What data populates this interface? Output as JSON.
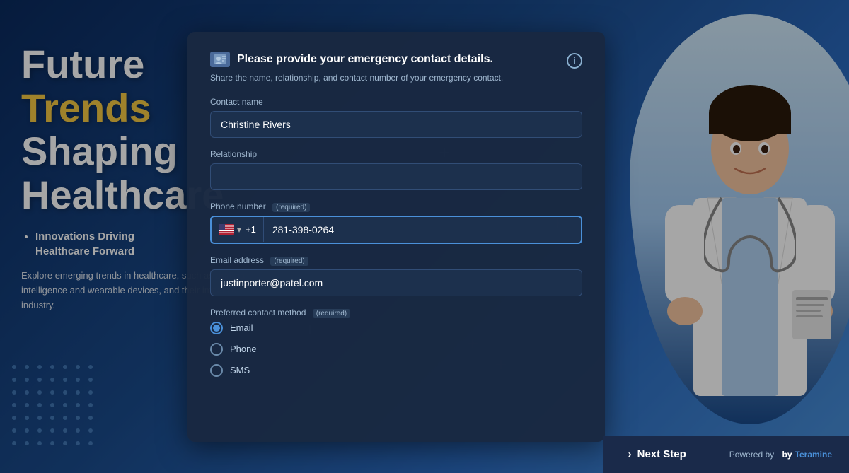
{
  "background": {
    "gradient_start": "#0a2a5e",
    "gradient_end": "#4a90d9"
  },
  "left_content": {
    "headline_line1": "Future",
    "headline_line2": "Trends",
    "headline_line3": "Shaping",
    "headline_line4": "Healthcare",
    "bullet1": "Innovations Driving",
    "bullet1_cont": "Healthcare Forward",
    "body_text": "Explore emerging trends in healthcare, such as artificial intelligence and wearable devices, and their impact on the industry."
  },
  "modal": {
    "title": "Please provide your emergency contact details.",
    "subtitle": "Share the name, relationship, and contact number of your emergency contact.",
    "fields": {
      "contact_name_label": "Contact name",
      "contact_name_value": "Christine Rivers",
      "relationship_label": "Relationship",
      "relationship_value": "",
      "phone_label": "Phone number",
      "phone_required": "required",
      "phone_country_code": "+1",
      "phone_value": "281-398-0264",
      "email_label": "Email address",
      "email_required": "required",
      "email_value": "justinporter@patel.com",
      "preferred_method_label": "Preferred contact method",
      "preferred_method_required": "required",
      "options": [
        "Email",
        "Phone",
        "SMS"
      ],
      "selected_option": "Email"
    }
  },
  "footer": {
    "next_step_label": "Next Step",
    "arrow": "›",
    "powered_by_label": "Powered by",
    "brand_name": "Teramine"
  }
}
